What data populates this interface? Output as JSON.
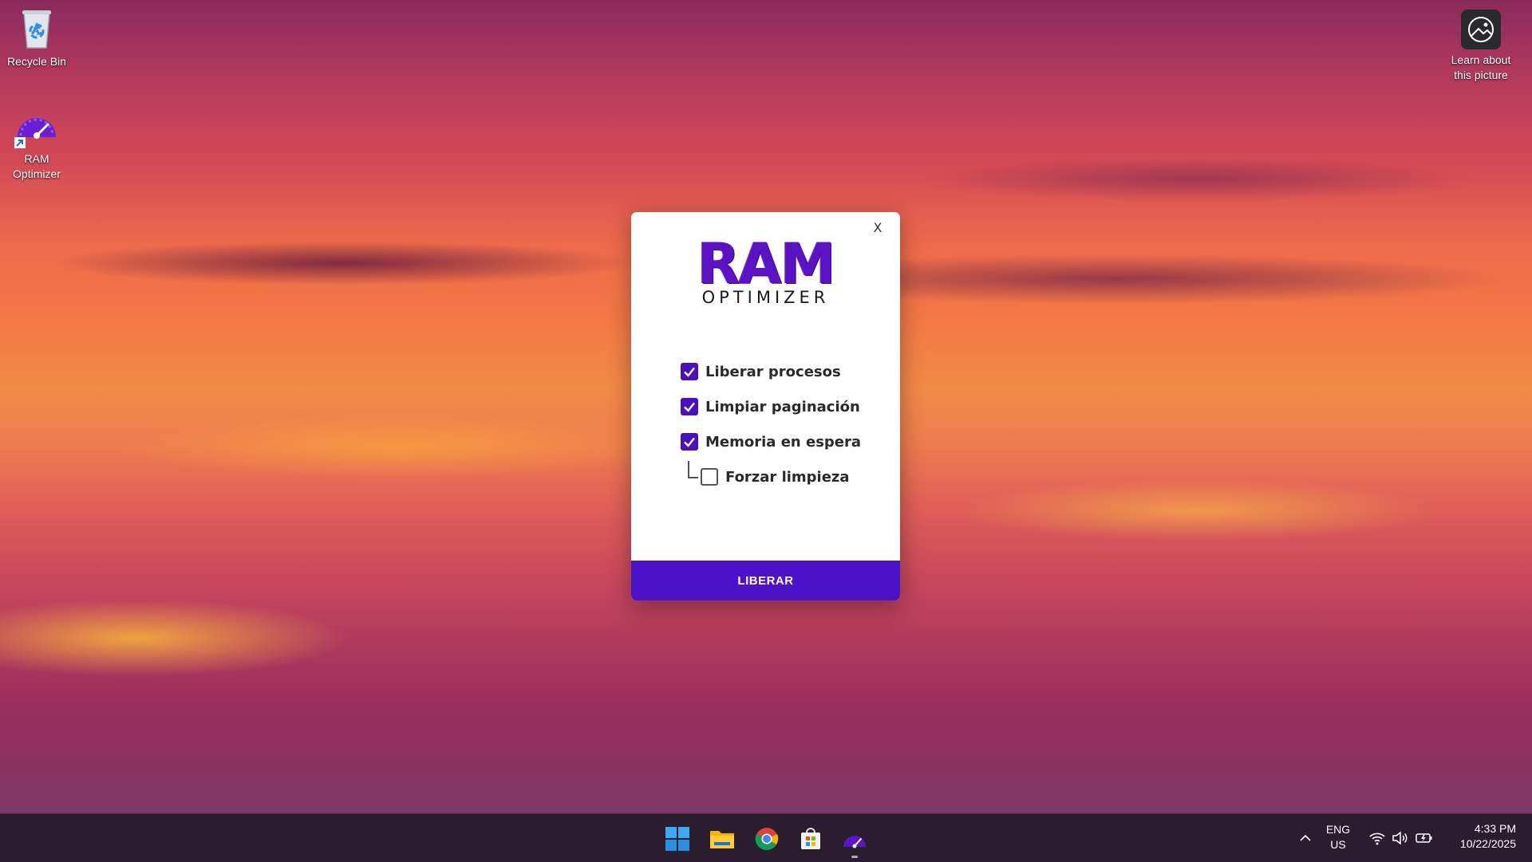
{
  "desktop": {
    "icons": [
      {
        "label": "Recycle Bin"
      },
      {
        "label": "RAM Optimizer"
      }
    ],
    "spotlight": {
      "label": "Learn about this picture"
    }
  },
  "dialog": {
    "close_label": "X",
    "logo": {
      "main": "RAM",
      "sub": "OPTIMIZER"
    },
    "options": [
      {
        "label": "Liberar procesos",
        "checked": true
      },
      {
        "label": "Limpiar paginación",
        "checked": true
      },
      {
        "label": "Memoria en espera",
        "checked": true
      },
      {
        "label": "Forzar limpieza",
        "checked": false
      }
    ],
    "action_label": "LIBERAR",
    "accent_color": "#4c12c9"
  },
  "taskbar": {
    "apps": [
      {
        "icon": "windows-start-icon"
      },
      {
        "icon": "file-explorer-icon"
      },
      {
        "icon": "chrome-icon"
      },
      {
        "icon": "microsoft-store-icon"
      },
      {
        "icon": "ram-optimizer-icon"
      }
    ],
    "language": {
      "line1": "ENG",
      "line2": "US"
    },
    "clock": {
      "time": "4:33 PM",
      "date": "10/22/2025"
    }
  }
}
